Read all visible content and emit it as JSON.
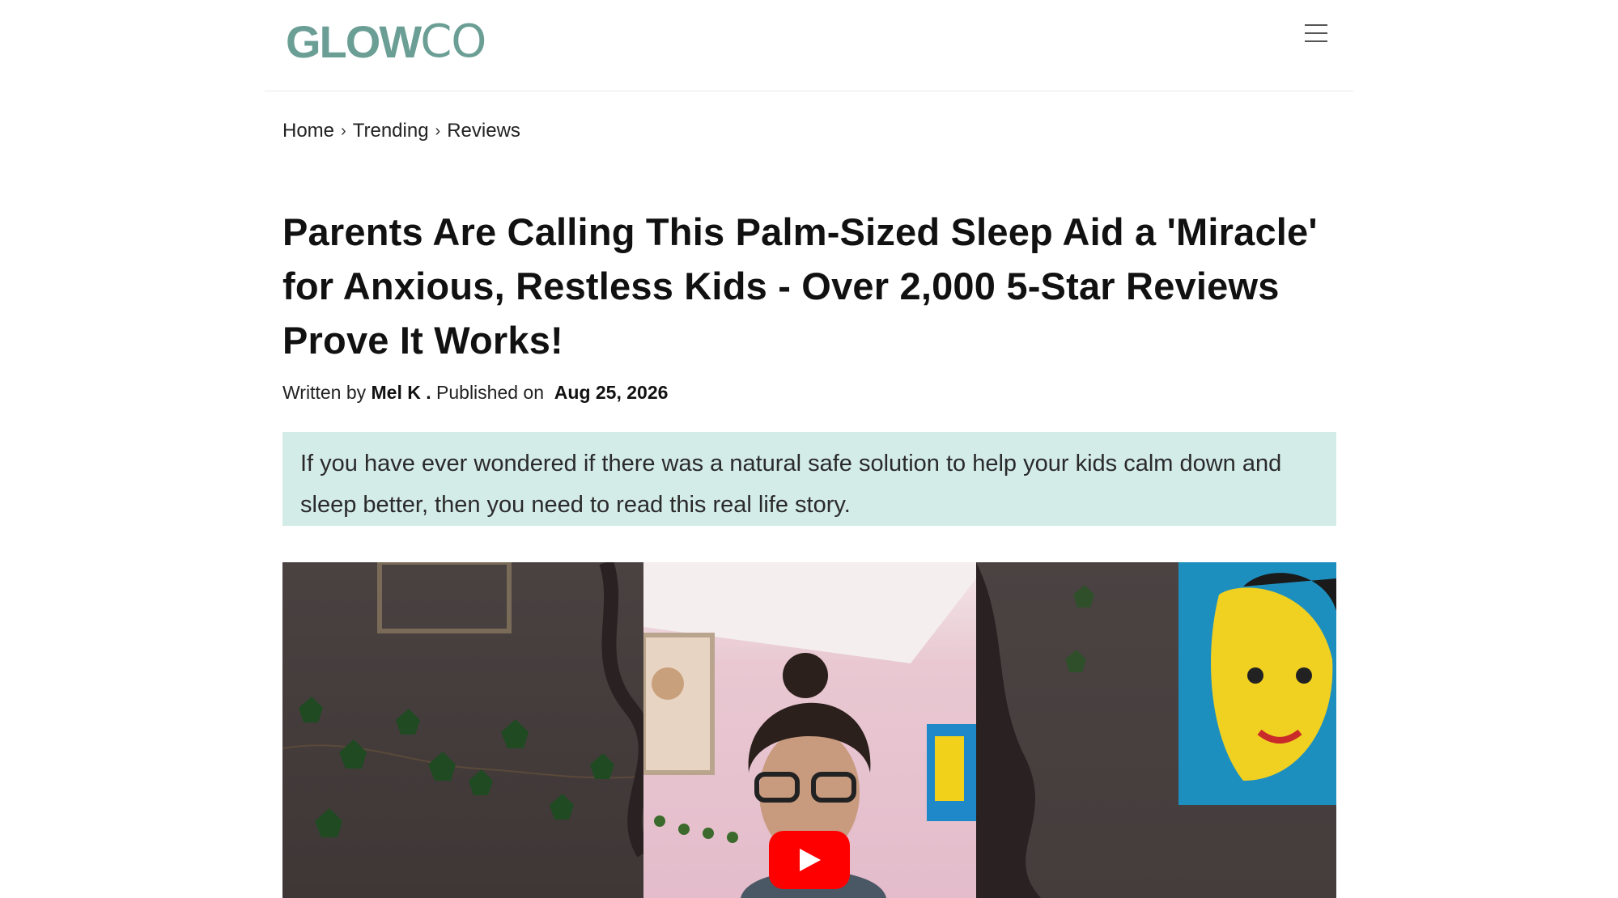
{
  "header": {
    "logo": {
      "part1": "GLOW",
      "part2": "CO",
      "color": "#6b9e95"
    },
    "menu_icon": "hamburger-menu-icon"
  },
  "breadcrumb": {
    "items": [
      "Home",
      "Trending",
      "Reviews"
    ],
    "separator": "›"
  },
  "article": {
    "title": "Parents Are Calling This Palm-Sized Sleep Aid a 'Miracle' for Anxious, Restless Kids - Over 2,000 5-Star Reviews Prove It Works!",
    "byline": {
      "written_by_label": "Written by",
      "author": "Mel K .",
      "published_label": "Published on",
      "date": "Aug 25, 2026"
    },
    "intro": "If you have ever wondered if there was a natural safe solution to help your kids calm down and sleep better, then you need to read this real life story."
  },
  "video": {
    "play_icon": "youtube-play-icon",
    "play_color": "#ff0000"
  },
  "colors": {
    "intro_bg": "#d4ece8",
    "text": "#111111"
  }
}
